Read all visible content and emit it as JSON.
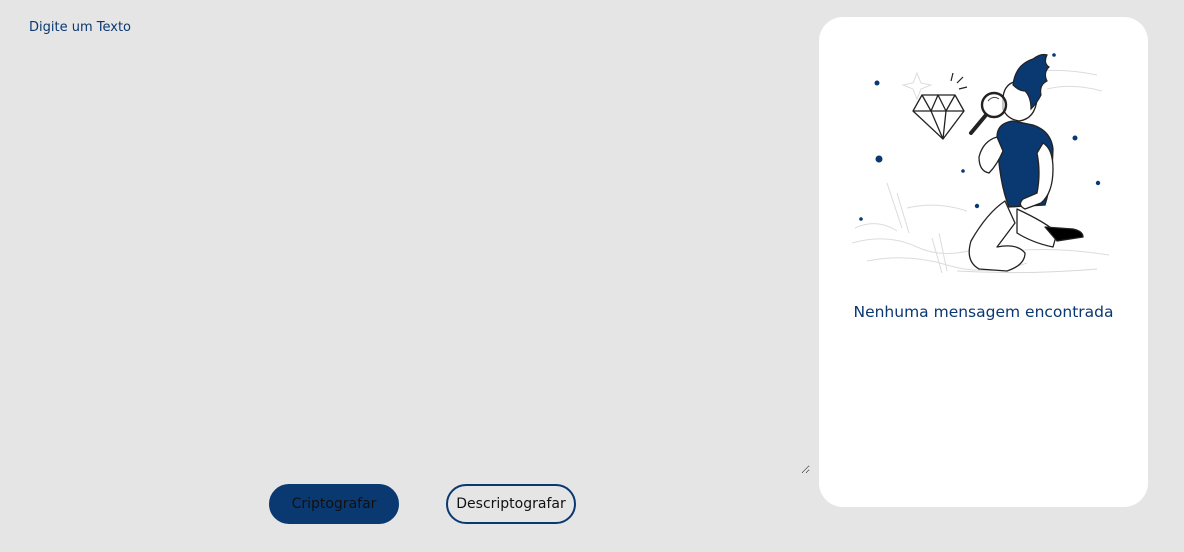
{
  "input": {
    "placeholder": "Digite um Texto",
    "value": ""
  },
  "buttons": {
    "encrypt_label": "Criptografar",
    "decrypt_label": "Descriptografar"
  },
  "output": {
    "empty_message": "Nenhuma mensagem encontrada",
    "illustration_icon": "person-with-magnifying-glass-icon"
  },
  "colors": {
    "background": "#e5e5e5",
    "accent": "#0a3871",
    "card": "#ffffff"
  }
}
